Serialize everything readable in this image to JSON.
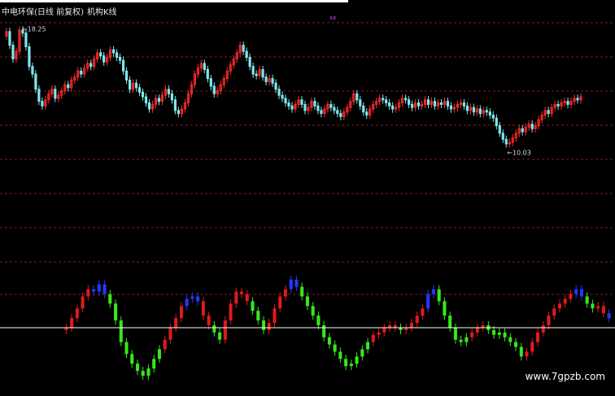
{
  "title": {
    "stock": "中电环保",
    "mode": "(日线 前复权)",
    "indicator": "机构K线"
  },
  "top_marker": "xx",
  "watermark": "www.7gpzb.com",
  "colors": {
    "background": "#000000",
    "up": "#ff2a2a",
    "down": "#7fe8ee",
    "flat": "#ffffff",
    "grid": "#8a1a1a",
    "ind_up": "#e01a1a",
    "ind_down": "#37e81c",
    "ind_mixed": "#2338ff",
    "baseline": "#ffffff"
  },
  "chart_data": [
    {
      "type": "candlestick",
      "title": "",
      "high_label": "18.25",
      "low_label": "10.03",
      "ylim": [
        9.6,
        18.6
      ],
      "open": [
        17.4,
        17.7,
        16.8,
        15.9,
        16.4,
        17.8,
        17.6,
        16.7,
        15.4,
        14.9,
        13.9,
        13.1,
        12.8,
        13.2,
        13.6,
        13.9,
        13.3,
        13.5,
        13.8,
        14.2,
        14.0,
        14.5,
        14.7,
        15.1,
        14.9,
        15.3,
        15.6,
        15.4,
        15.9,
        16.3,
        16.1,
        15.7,
        16.0,
        16.5,
        16.3,
        16.0,
        15.8,
        15.1,
        14.5,
        13.9,
        14.3,
        14.0,
        13.7,
        13.4,
        13.0,
        12.6,
        12.9,
        13.3,
        13.1,
        13.5,
        13.9,
        13.6,
        13.2,
        12.5,
        12.3,
        12.6,
        13.0,
        13.6,
        14.2,
        14.9,
        15.3,
        15.6,
        15.2,
        14.6,
        14.1,
        13.6,
        13.8,
        14.2,
        14.6,
        15.1,
        15.5,
        15.9,
        16.3,
        16.8,
        16.4,
        16.0,
        15.4,
        14.9,
        14.8,
        15.2,
        14.7,
        14.4,
        14.6,
        14.3,
        13.9,
        13.5,
        13.3,
        13.0,
        12.8,
        12.6,
        12.9,
        13.2,
        12.9,
        12.5,
        12.7,
        13.1,
        12.8,
        12.5,
        12.3,
        12.6,
        12.9,
        12.7,
        12.5,
        12.3,
        12.1,
        12.4,
        12.7,
        13.1,
        13.6,
        13.2,
        12.8,
        12.4,
        12.2,
        12.6,
        12.9,
        13.1,
        13.3,
        13.2,
        13.0,
        12.8,
        12.6,
        12.7,
        13.0,
        13.3,
        13.2,
        12.9,
        12.7,
        13.0,
        12.8,
        12.9,
        13.2,
        12.9,
        13.1,
        12.8,
        13.0,
        12.9,
        13.1,
        12.8,
        12.6,
        12.7,
        12.9,
        13.0,
        12.8,
        12.5,
        12.7,
        12.4,
        12.6,
        12.3,
        12.5,
        12.4,
        12.2,
        12.0,
        11.5,
        11.0,
        10.6,
        10.3,
        10.4,
        10.7,
        11.0,
        11.3,
        11.1,
        11.4,
        11.6,
        11.3,
        11.5,
        11.9,
        12.2,
        12.5,
        12.3,
        12.7,
        12.9,
        12.8,
        13.0,
        13.1,
        12.9,
        13.1,
        13.3,
        13.2
      ],
      "close": [
        17.7,
        16.8,
        15.9,
        16.4,
        17.8,
        17.6,
        16.7,
        15.4,
        14.9,
        13.9,
        13.1,
        12.8,
        13.2,
        13.6,
        13.9,
        13.3,
        13.5,
        13.8,
        14.2,
        14.0,
        14.5,
        14.7,
        15.1,
        14.9,
        15.3,
        15.6,
        15.4,
        15.9,
        16.3,
        16.1,
        15.7,
        16.0,
        16.5,
        16.3,
        16.0,
        15.8,
        15.1,
        14.5,
        13.9,
        14.3,
        14.0,
        13.7,
        13.4,
        13.0,
        12.6,
        12.9,
        13.3,
        13.1,
        13.5,
        13.9,
        13.6,
        13.2,
        12.5,
        12.3,
        12.6,
        13.0,
        13.6,
        14.2,
        14.9,
        15.3,
        15.6,
        15.2,
        14.6,
        14.1,
        13.6,
        13.8,
        14.2,
        14.6,
        15.1,
        15.5,
        15.9,
        16.3,
        16.8,
        16.4,
        16.0,
        15.4,
        14.9,
        14.8,
        15.2,
        14.7,
        14.4,
        14.6,
        14.3,
        13.9,
        13.5,
        13.3,
        13.0,
        12.8,
        12.6,
        12.9,
        13.2,
        12.9,
        12.5,
        12.7,
        13.1,
        12.8,
        12.5,
        12.3,
        12.6,
        12.9,
        12.7,
        12.5,
        12.3,
        12.1,
        12.4,
        12.7,
        13.1,
        13.6,
        13.2,
        12.8,
        12.4,
        12.2,
        12.6,
        12.9,
        13.1,
        13.3,
        13.2,
        13.0,
        12.8,
        12.6,
        12.7,
        13.0,
        13.3,
        13.2,
        12.9,
        12.7,
        13.0,
        12.8,
        12.9,
        13.2,
        12.9,
        13.1,
        12.8,
        13.0,
        12.9,
        13.1,
        12.8,
        12.6,
        12.7,
        12.9,
        13.0,
        12.8,
        12.5,
        12.7,
        12.4,
        12.6,
        12.3,
        12.5,
        12.4,
        12.2,
        12.0,
        11.5,
        11.0,
        10.6,
        10.3,
        10.4,
        10.7,
        11.0,
        11.3,
        11.1,
        11.4,
        11.6,
        11.3,
        11.5,
        11.9,
        12.2,
        12.5,
        12.3,
        12.7,
        12.9,
        12.8,
        13.0,
        13.1,
        12.9,
        13.1,
        13.3,
        13.2,
        13.4
      ]
    },
    {
      "type": "indicator-bars",
      "title": "",
      "ylim": [
        -1.0,
        1.2
      ],
      "baseline": 0,
      "values": [
        0.05,
        0.25,
        0.45,
        0.7,
        0.85,
        0.8,
        0.95,
        0.75,
        0.55,
        0.2,
        -0.25,
        -0.5,
        -0.7,
        -0.85,
        -0.95,
        -0.8,
        -0.6,
        -0.4,
        -0.2,
        0.05,
        0.25,
        0.5,
        0.65,
        0.7,
        0.6,
        0.3,
        0.1,
        -0.05,
        -0.2,
        0.2,
        0.55,
        0.8,
        0.75,
        0.6,
        0.4,
        0.2,
        0.0,
        0.15,
        0.45,
        0.7,
        0.85,
        1.05,
        0.9,
        0.7,
        0.5,
        0.3,
        0.1,
        -0.15,
        -0.3,
        -0.45,
        -0.6,
        -0.75,
        -0.7,
        -0.55,
        -0.4,
        -0.25,
        -0.1,
        -0.05,
        0.05,
        0.1,
        0.05,
        0.0,
        0.05,
        0.15,
        0.3,
        0.45,
        0.75,
        0.85,
        0.6,
        0.3,
        0.05,
        -0.2,
        -0.25,
        -0.15,
        -0.05,
        0.05,
        0.1,
        0.0,
        -0.1,
        -0.05,
        -0.15,
        -0.25,
        -0.35,
        -0.55,
        -0.45,
        -0.25,
        -0.05,
        0.1,
        0.3,
        0.45,
        0.55,
        0.65,
        0.75,
        0.85,
        0.7,
        0.55,
        0.45,
        0.5,
        0.35,
        0.25
      ],
      "states": [
        "u",
        "u",
        "u",
        "u",
        "u",
        "m",
        "m",
        "m",
        "d",
        "d",
        "d",
        "d",
        "d",
        "d",
        "d",
        "d",
        "d",
        "d",
        "u",
        "u",
        "u",
        "u",
        "m",
        "m",
        "m",
        "u",
        "u",
        "d",
        "d",
        "u",
        "u",
        "u",
        "u",
        "u",
        "d",
        "d",
        "d",
        "u",
        "u",
        "u",
        "u",
        "m",
        "m",
        "d",
        "d",
        "d",
        "d",
        "d",
        "d",
        "d",
        "d",
        "d",
        "d",
        "d",
        "d",
        "d",
        "u",
        "u",
        "u",
        "u",
        "u",
        "d",
        "u",
        "u",
        "u",
        "u",
        "m",
        "m",
        "d",
        "d",
        "d",
        "d",
        "d",
        "d",
        "u",
        "u",
        "u",
        "d",
        "d",
        "d",
        "d",
        "d",
        "d",
        "d",
        "u",
        "u",
        "u",
        "u",
        "u",
        "u",
        "u",
        "u",
        "u",
        "m",
        "m",
        "d",
        "d",
        "u",
        "u",
        "m"
      ]
    }
  ]
}
